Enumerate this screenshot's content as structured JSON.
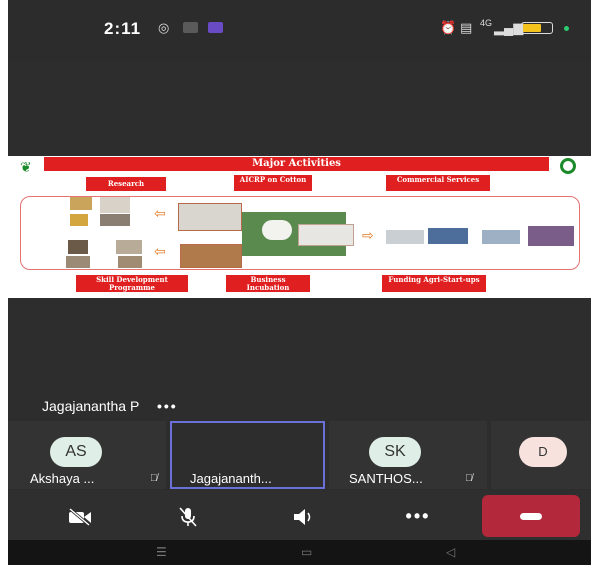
{
  "status_bar": {
    "time": "2:11",
    "network": "4G"
  },
  "slide": {
    "title": "Major Activities",
    "top_boxes": [
      "Research",
      "AICRP on Cotton",
      "Commercial Services"
    ],
    "bottom_boxes": [
      "Skill Development Programme",
      "Business Incubation",
      "Funding Agri-Start-ups"
    ]
  },
  "speaker": {
    "name": "Jagajanantha P",
    "more": "•••"
  },
  "participants": [
    {
      "initials": "AS",
      "name": "Akshaya ...",
      "muted": true
    },
    {
      "initials": "",
      "name": "Jagajananth...",
      "muted": false
    },
    {
      "initials": "SK",
      "name": "SANTHOS...",
      "muted": true
    },
    {
      "initials": "D",
      "name": "",
      "muted": false
    }
  ],
  "controls": {
    "more_label": "•••"
  },
  "colors": {
    "end_call": "#b3283a",
    "active_border": "#6b6fd8",
    "slide_red": "#e02020"
  }
}
